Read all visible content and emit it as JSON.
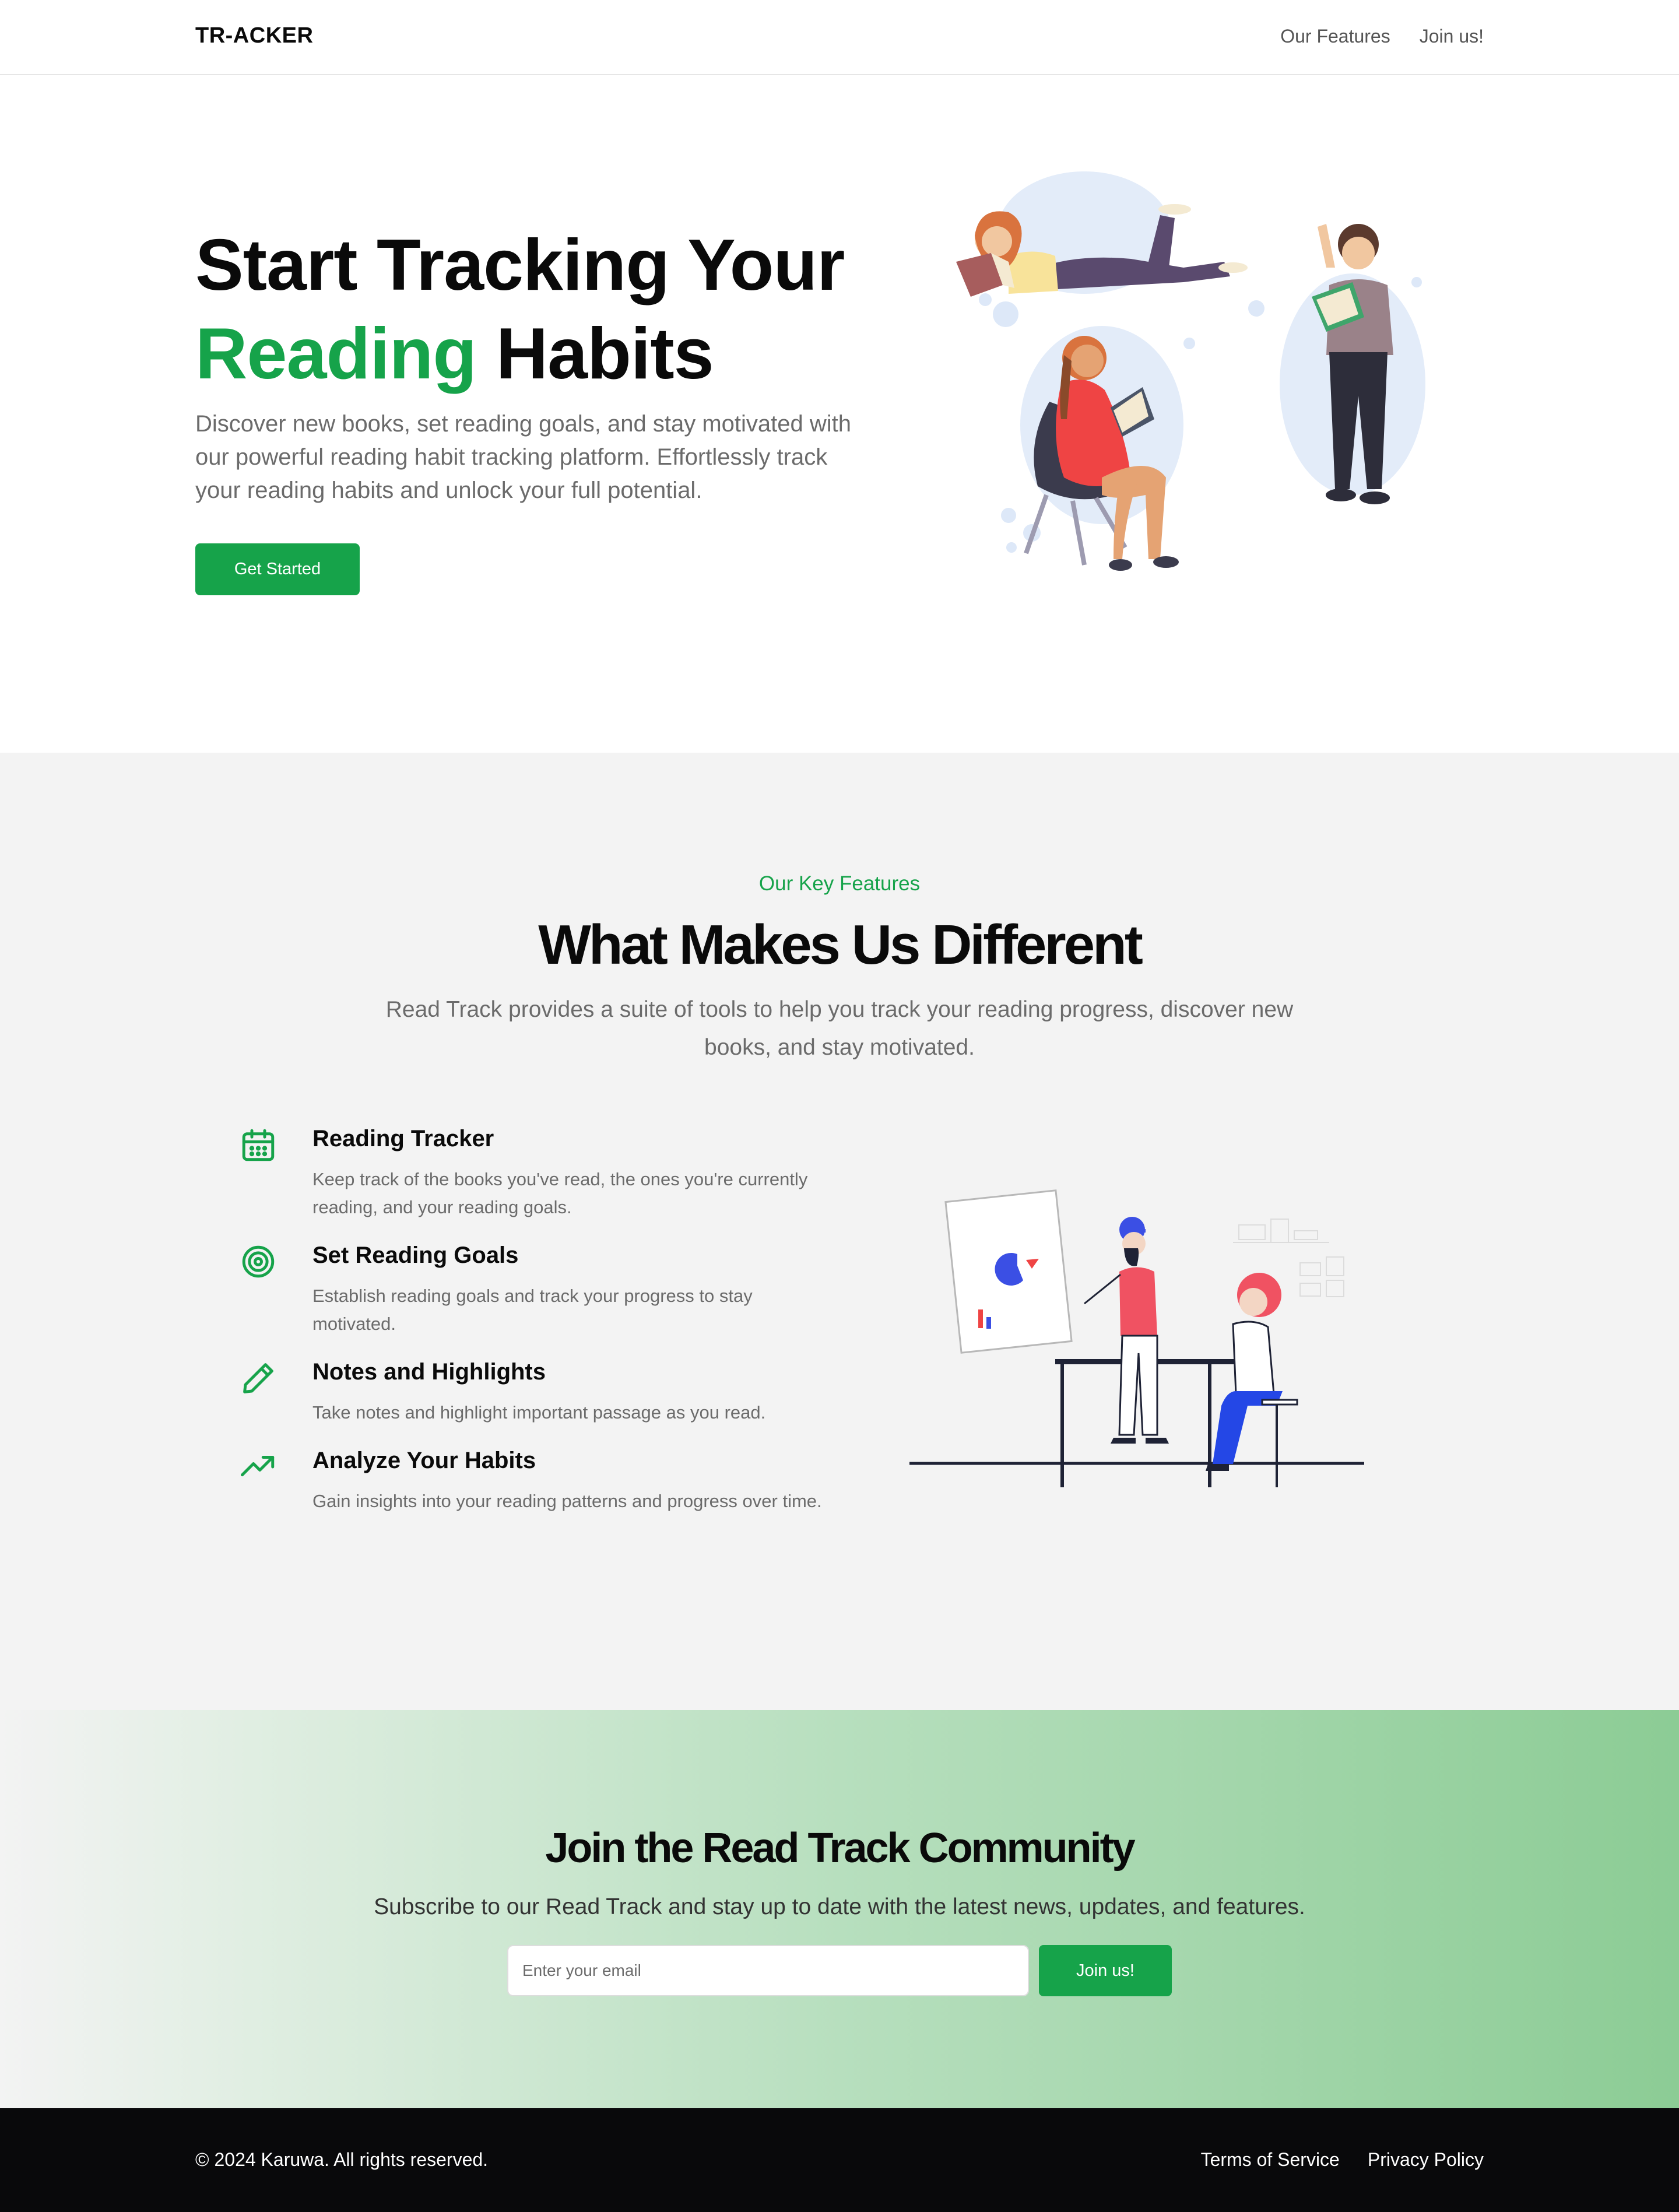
{
  "nav": {
    "logo": "TR-ACKER",
    "links": [
      "Our Features",
      "Join us!"
    ]
  },
  "hero": {
    "title_line1": "Start Tracking Your",
    "title_highlight": "Reading",
    "title_rest": "Habits",
    "description": "Discover new books, set reading goals, and stay motivated with our powerful reading habit tracking platform. Effortlessly track your reading habits and unlock your full potential.",
    "cta": "Get Started"
  },
  "features": {
    "kicker": "Our Key Features",
    "title": "What Makes Us Different",
    "subtitle": "Read Track provides a suite of tools to help you track your reading progress, discover new books, and stay motivated.",
    "items": [
      {
        "icon": "calendar-icon",
        "title": "Reading Tracker",
        "desc": "Keep track of the books you've read, the ones you're currently reading, and your reading goals."
      },
      {
        "icon": "target-icon",
        "title": "Set Reading Goals",
        "desc": "Establish reading goals and track your progress to stay motivated."
      },
      {
        "icon": "pencil-icon",
        "title": "Notes and Highlights",
        "desc": "Take notes and highlight important passage as you read."
      },
      {
        "icon": "trending-up-icon",
        "title": "Analyze Your Habits",
        "desc": "Gain insights into your reading patterns and progress over time."
      }
    ]
  },
  "community": {
    "title": "Join the Read Track Community",
    "subtitle": "Subscribe to our Read Track and stay up to date with the latest news, updates, and features.",
    "email_placeholder": "Enter your email",
    "button": "Join us!"
  },
  "footer": {
    "copyright": "© 2024 Karuwa. All rights reserved.",
    "links": [
      "Terms of Service",
      "Privacy Policy"
    ]
  },
  "colors": {
    "accent": "#16a34a",
    "text": "#0a0a0a",
    "muted": "#6b6b6b",
    "footer_bg": "#09090b"
  }
}
